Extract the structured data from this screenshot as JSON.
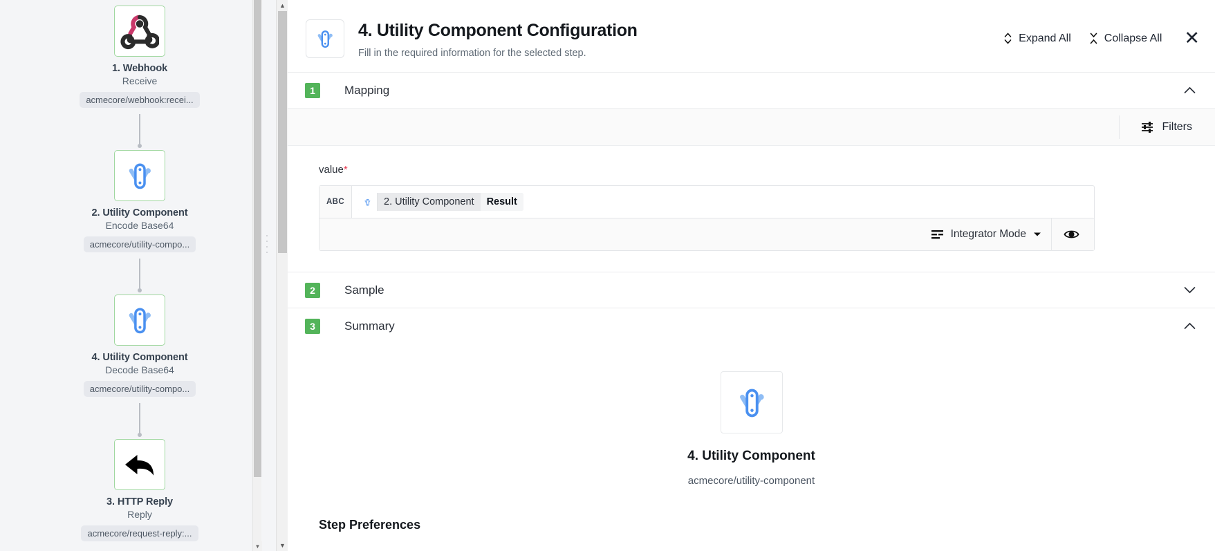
{
  "flow": {
    "nodes": [
      {
        "title": "1. Webhook",
        "subtitle": "Receive",
        "path": "acmecore/webhook:recei...",
        "icon": "webhook-icon",
        "selected": false
      },
      {
        "title": "2. Utility Component",
        "subtitle": "Encode Base64",
        "path": "acmecore/utility-compo...",
        "icon": "utility-component-icon",
        "selected": false
      },
      {
        "title": "4. Utility Component",
        "subtitle": "Decode Base64",
        "path": "acmecore/utility-compo...",
        "icon": "utility-component-icon",
        "selected": true
      },
      {
        "title": "3. HTTP Reply",
        "subtitle": "Reply",
        "path": "acmecore/request-reply:...",
        "icon": "http-reply-arrow-icon",
        "selected": false
      }
    ]
  },
  "header": {
    "title": "4. Utility Component Configuration",
    "subtitle": "Fill in the required information for the selected step.",
    "icon": "utility-component-icon",
    "expand_all_label": "Expand All",
    "collapse_all_label": "Collapse All",
    "close_label": "✕"
  },
  "sections": [
    {
      "number": "1",
      "label": "Mapping",
      "expanded": true
    },
    {
      "number": "2",
      "label": "Sample",
      "expanded": false
    },
    {
      "number": "3",
      "label": "Summary",
      "expanded": true
    }
  ],
  "mapping": {
    "filters_label": "Filters",
    "field_label": "value",
    "required_marker": "*",
    "type_badge": "ABC",
    "chip": {
      "step_name": "2. Utility Component",
      "value": "Result",
      "icon": "utility-component-icon"
    },
    "mode_label": "Integrator Mode",
    "preview_icon": "eye-icon"
  },
  "summary": {
    "title": "4. Utility Component",
    "path": "acmecore/utility-component",
    "icon": "utility-component-icon",
    "step_preferences_label": "Step Preferences"
  },
  "colors": {
    "section_badge_green": "#53b45a",
    "node_border_green": "#b9e0b9",
    "required_red": "#e8384f",
    "utility_blue": "#4a90f0",
    "webhook_pink": "#c9386a",
    "panel_bg": "#f4f5f7"
  }
}
